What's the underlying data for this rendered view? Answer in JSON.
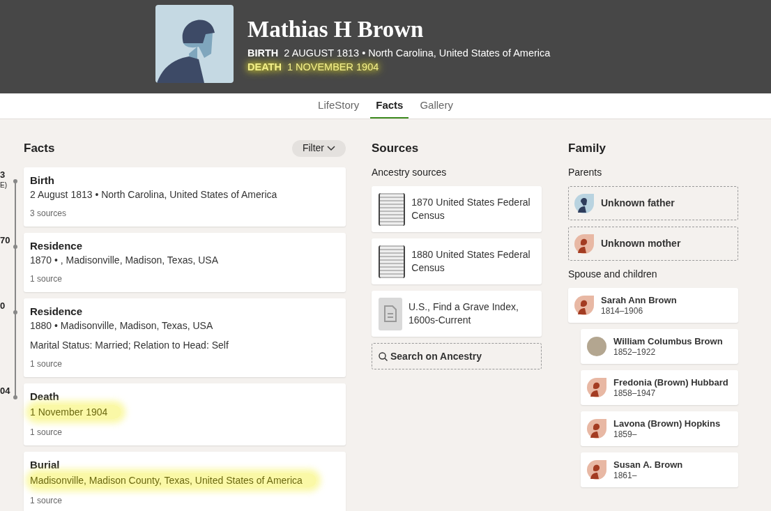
{
  "person": {
    "name": "Mathias H Brown",
    "events": [
      {
        "label": "BIRTH",
        "value": "2 AUGUST 1813 • North Carolina, United States of America",
        "highlighted": false
      },
      {
        "label": "DEATH",
        "value": "1 NOVEMBER 1904",
        "highlighted": true
      }
    ]
  },
  "tabs": [
    {
      "label": "LifeStory",
      "selected": false
    },
    {
      "label": "Facts",
      "selected": true
    },
    {
      "label": "Gallery",
      "selected": false
    }
  ],
  "facts": {
    "title": "Facts",
    "filter": "Filter",
    "timeline_labels": [
      [
        "3",
        "E)"
      ],
      [
        "70"
      ],
      [
        "0"
      ],
      [
        "04"
      ]
    ],
    "items": [
      {
        "title": "Birth",
        "detail": "2 August 1813 • North Carolina, United States of America",
        "sources": "3 sources",
        "highlighted": false,
        "on_timeline": true
      },
      {
        "title": "Residence",
        "detail": "1870 • , Madisonville, Madison, Texas, USA",
        "sources": "1 source",
        "highlighted": false,
        "on_timeline": true
      },
      {
        "title": "Residence",
        "detail": "1880 • Madisonville, Madison, Texas, USA",
        "note": "Marital Status: Married; Relation to Head: Self",
        "sources": "1 source",
        "highlighted": false,
        "on_timeline": true
      },
      {
        "title": "Death",
        "detail": "1 November 1904",
        "sources": "1 source",
        "highlighted": true,
        "on_timeline": true
      },
      {
        "title": "Burial",
        "detail": "Madisonville, Madison County, Texas, United States of America",
        "sources": "1 source",
        "highlighted": true,
        "on_timeline": false
      }
    ]
  },
  "sources": {
    "title": "Sources",
    "subtitle": "Ancestry sources",
    "items": [
      {
        "kind": "scan",
        "title": "1870 United States Federal Census"
      },
      {
        "kind": "scan",
        "title": "1880 United States Federal Census"
      },
      {
        "kind": "document",
        "title": "U.S., Find a Grave Index, 1600s-Current"
      }
    ],
    "search": "Search on Ancestry"
  },
  "family": {
    "title": "Family",
    "parents_label": "Parents",
    "parents": [
      {
        "kind": "male",
        "name": "Unknown father"
      },
      {
        "kind": "female",
        "name": "Unknown mother"
      }
    ],
    "spouse_label": "Spouse and children",
    "spouse": {
      "kind": "female",
      "name": "Sarah Ann Brown",
      "years": "1814–1906"
    },
    "children": [
      {
        "kind": "photo",
        "name": "William Columbus Brown",
        "years": "1852–1922"
      },
      {
        "kind": "female",
        "name": "Fredonia (Brown) Hubbard",
        "years": "1858–1947"
      },
      {
        "kind": "female",
        "name": "Lavona (Brown) Hopkins",
        "years": "1859–"
      },
      {
        "kind": "female",
        "name": "Susan A. Brown",
        "years": "1861–"
      }
    ]
  }
}
